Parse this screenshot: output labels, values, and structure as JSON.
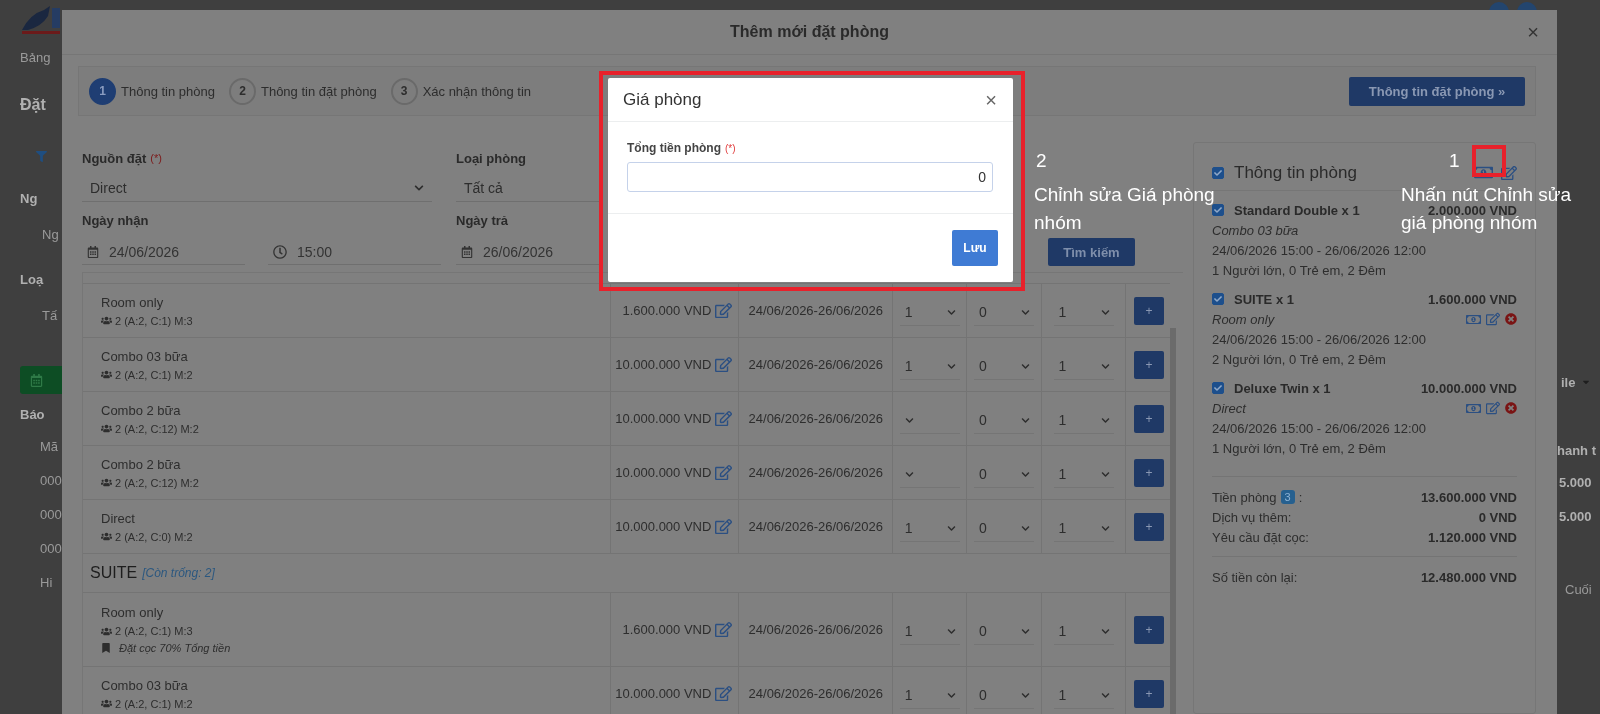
{
  "background_page": {
    "left": [
      {
        "kind": "logo"
      },
      {
        "kind": "nav",
        "text": "Bảng"
      },
      {
        "kind": "title",
        "text": "Đặt"
      },
      {
        "kind": "filter"
      },
      {
        "kind": "label",
        "text": "Ng"
      },
      {
        "kind": "input",
        "text": "Ng"
      },
      {
        "kind": "label",
        "text": "Loạ"
      },
      {
        "kind": "input",
        "text": "Tấ"
      },
      {
        "kind": "button"
      },
      {
        "kind": "heading",
        "text": "Báo"
      },
      {
        "kind": "cell",
        "text": "Mã"
      },
      {
        "kind": "cell",
        "text": "000"
      },
      {
        "kind": "cell",
        "text": "000"
      },
      {
        "kind": "cell",
        "text": "000"
      },
      {
        "kind": "cell",
        "text": "Hi"
      }
    ],
    "right": [
      {
        "kind": "dropdown",
        "text": "ile"
      },
      {
        "kind": "header",
        "text": "hanh t"
      },
      {
        "kind": "cell",
        "text": "5.000"
      },
      {
        "kind": "cell",
        "text": "5.000"
      },
      {
        "kind": "pager",
        "text": "Cuối"
      }
    ]
  },
  "modal": {
    "title": "Thêm mới đặt phòng",
    "close": "×",
    "steps": [
      {
        "number": "1",
        "label": "Thông tin phòng",
        "selected": true
      },
      {
        "number": "2",
        "label": "Thông tin đặt phòng",
        "selected": false
      },
      {
        "number": "3",
        "label": "Xác nhận thông tin",
        "selected": false
      }
    ],
    "next_button": "Thông tin đặt phòng »",
    "form": {
      "source": {
        "label": "Nguồn đặt",
        "required": "(*)",
        "value": "Direct"
      },
      "room_type": {
        "label": "Loại phòng",
        "value": "Tất cả"
      },
      "checkin": {
        "label": "Ngày nhận",
        "date": "24/06/2026",
        "time": "15:00"
      },
      "checkout": {
        "label": "Ngày trả",
        "date": "26/06/2026"
      },
      "search_button": "Tìm kiếm"
    },
    "rooms": [
      {
        "kind": "rate",
        "name": "Room only",
        "capacity": "2 (A:2, C:1) M:3",
        "price": "1.600.000 VND",
        "dates": "24/06/2026-26/06/2026",
        "adults": "1",
        "children": "0",
        "quantity": "1",
        "add": "+"
      },
      {
        "kind": "rate",
        "name": "Combo 03 bữa",
        "capacity": "2 (A:2, C:1) M:2",
        "price": "10.000.000 VND",
        "dates": "24/06/2026-26/06/2026",
        "adults": "1",
        "children": "0",
        "quantity": "1",
        "add": "+"
      },
      {
        "kind": "rate",
        "name": "Combo 2 bữa",
        "capacity": "2 (A:2, C:12) M:2",
        "price": "10.000.000 VND",
        "dates": "24/06/2026-26/06/2026",
        "children": "0",
        "quantity": "1",
        "add": "+"
      },
      {
        "kind": "rate",
        "name": "Combo 2 bữa",
        "capacity": "2 (A:2, C:12) M:2",
        "price": "10.000.000 VND",
        "dates": "24/06/2026-26/06/2026",
        "children": "0",
        "quantity": "1",
        "add": "+"
      },
      {
        "kind": "rate",
        "name": "Direct",
        "capacity": "2 (A:2, C:0) M:2",
        "price": "10.000.000 VND",
        "dates": "24/06/2026-26/06/2026",
        "adults": "1",
        "children": "0",
        "quantity": "1",
        "add": "+"
      },
      {
        "kind": "group",
        "name": "SUITE",
        "availability": "[Còn trống: 2]"
      },
      {
        "kind": "rate",
        "name": "Room only",
        "capacity": "2 (A:2, C:1) M:3",
        "note": "Đặt cọc 70% Tổng tiền",
        "price": "1.600.000 VND",
        "dates": "24/06/2026-26/06/2026",
        "adults": "1",
        "children": "0",
        "quantity": "1",
        "add": "+"
      },
      {
        "kind": "rate",
        "name": "Combo 03 bữa",
        "capacity": "2 (A:2, C:1) M:2",
        "price": "10.000.000 VND",
        "dates": "24/06/2026-26/06/2026",
        "adults": "1",
        "children": "0",
        "quantity": "1",
        "add": "+"
      }
    ],
    "summary": {
      "title": "Thông tin phòng",
      "checked": true,
      "items": [
        {
          "name": "Standard Double x 1",
          "price": "2.000.000 VND",
          "rate": "Combo 03 bữa",
          "dates": "24/06/2026 15:00 - 26/06/2026 12:00",
          "guests": "1 Người lớn, 0 Trẻ em, 2 Đêm",
          "checked": true,
          "actions": false
        },
        {
          "name": "SUITE x 1",
          "price": "1.600.000 VND",
          "rate": "Room only",
          "dates": "24/06/2026 15:00 - 26/06/2026 12:00",
          "guests": "2 Người lớn, 0 Trẻ em, 2 Đêm",
          "checked": true,
          "actions": true
        },
        {
          "name": "Deluxe Twin x 1",
          "price": "10.000.000 VND",
          "rate": "Direct",
          "dates": "24/06/2026 15:00 - 26/06/2026 12:00",
          "guests": "1 Người lớn, 0 Trẻ em, 2 Đêm",
          "checked": true,
          "actions": true
        }
      ],
      "totals": [
        {
          "label": "Tiền phòng",
          "badge": "3",
          "suffix": ":",
          "value": "13.600.000 VND"
        },
        {
          "label": "Dịch vụ thêm:",
          "value": "0 VND"
        },
        {
          "label": "Yêu cầu đặt cọc:",
          "value": "1.120.000 VND"
        }
      ],
      "balance": {
        "label": "Số tiền còn lại:",
        "value": "12.480.000 VND"
      }
    }
  },
  "price_dialog": {
    "title": "Giá phòng",
    "close": "×",
    "field_label": "Tổng tiền phòng",
    "required": "(*)",
    "value": "0",
    "save_button": "Lưu"
  },
  "annotations": [
    {
      "number": "2",
      "lines": [
        "Chỉnh sửa Giá phòng",
        "nhóm"
      ]
    },
    {
      "number": "1",
      "lines": [
        "Nhấn nút Chỉnh sửa",
        "giá phòng nhóm"
      ]
    }
  ]
}
